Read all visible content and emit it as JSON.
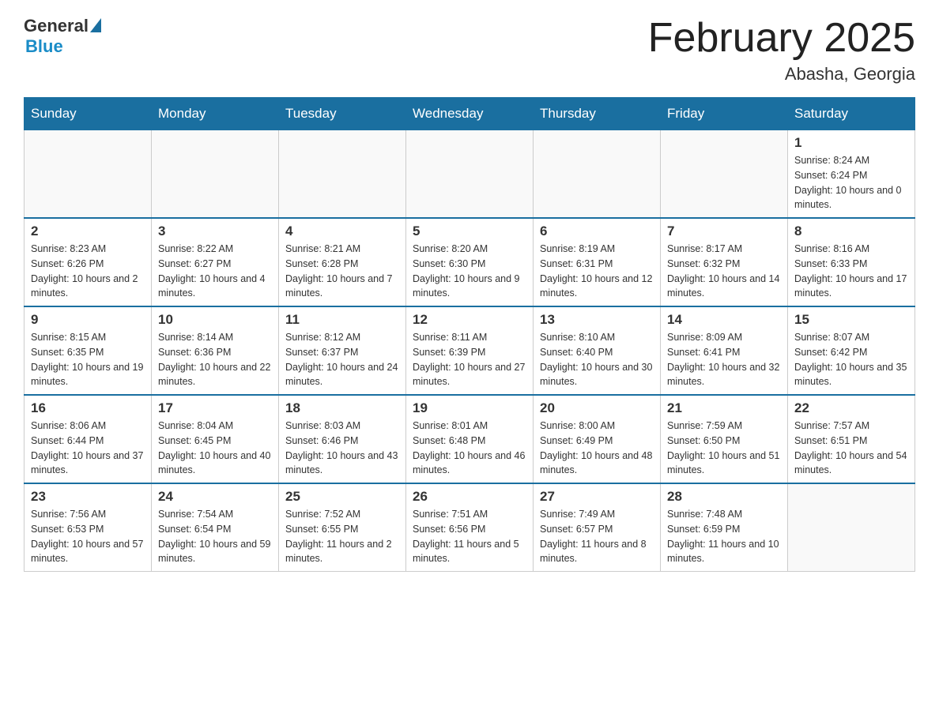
{
  "header": {
    "logo_general": "General",
    "logo_blue": "Blue",
    "title": "February 2025",
    "location": "Abasha, Georgia"
  },
  "calendar": {
    "days_of_week": [
      "Sunday",
      "Monday",
      "Tuesday",
      "Wednesday",
      "Thursday",
      "Friday",
      "Saturday"
    ],
    "weeks": [
      [
        {
          "day": "",
          "info": ""
        },
        {
          "day": "",
          "info": ""
        },
        {
          "day": "",
          "info": ""
        },
        {
          "day": "",
          "info": ""
        },
        {
          "day": "",
          "info": ""
        },
        {
          "day": "",
          "info": ""
        },
        {
          "day": "1",
          "info": "Sunrise: 8:24 AM\nSunset: 6:24 PM\nDaylight: 10 hours and 0 minutes."
        }
      ],
      [
        {
          "day": "2",
          "info": "Sunrise: 8:23 AM\nSunset: 6:26 PM\nDaylight: 10 hours and 2 minutes."
        },
        {
          "day": "3",
          "info": "Sunrise: 8:22 AM\nSunset: 6:27 PM\nDaylight: 10 hours and 4 minutes."
        },
        {
          "day": "4",
          "info": "Sunrise: 8:21 AM\nSunset: 6:28 PM\nDaylight: 10 hours and 7 minutes."
        },
        {
          "day": "5",
          "info": "Sunrise: 8:20 AM\nSunset: 6:30 PM\nDaylight: 10 hours and 9 minutes."
        },
        {
          "day": "6",
          "info": "Sunrise: 8:19 AM\nSunset: 6:31 PM\nDaylight: 10 hours and 12 minutes."
        },
        {
          "day": "7",
          "info": "Sunrise: 8:17 AM\nSunset: 6:32 PM\nDaylight: 10 hours and 14 minutes."
        },
        {
          "day": "8",
          "info": "Sunrise: 8:16 AM\nSunset: 6:33 PM\nDaylight: 10 hours and 17 minutes."
        }
      ],
      [
        {
          "day": "9",
          "info": "Sunrise: 8:15 AM\nSunset: 6:35 PM\nDaylight: 10 hours and 19 minutes."
        },
        {
          "day": "10",
          "info": "Sunrise: 8:14 AM\nSunset: 6:36 PM\nDaylight: 10 hours and 22 minutes."
        },
        {
          "day": "11",
          "info": "Sunrise: 8:12 AM\nSunset: 6:37 PM\nDaylight: 10 hours and 24 minutes."
        },
        {
          "day": "12",
          "info": "Sunrise: 8:11 AM\nSunset: 6:39 PM\nDaylight: 10 hours and 27 minutes."
        },
        {
          "day": "13",
          "info": "Sunrise: 8:10 AM\nSunset: 6:40 PM\nDaylight: 10 hours and 30 minutes."
        },
        {
          "day": "14",
          "info": "Sunrise: 8:09 AM\nSunset: 6:41 PM\nDaylight: 10 hours and 32 minutes."
        },
        {
          "day": "15",
          "info": "Sunrise: 8:07 AM\nSunset: 6:42 PM\nDaylight: 10 hours and 35 minutes."
        }
      ],
      [
        {
          "day": "16",
          "info": "Sunrise: 8:06 AM\nSunset: 6:44 PM\nDaylight: 10 hours and 37 minutes."
        },
        {
          "day": "17",
          "info": "Sunrise: 8:04 AM\nSunset: 6:45 PM\nDaylight: 10 hours and 40 minutes."
        },
        {
          "day": "18",
          "info": "Sunrise: 8:03 AM\nSunset: 6:46 PM\nDaylight: 10 hours and 43 minutes."
        },
        {
          "day": "19",
          "info": "Sunrise: 8:01 AM\nSunset: 6:48 PM\nDaylight: 10 hours and 46 minutes."
        },
        {
          "day": "20",
          "info": "Sunrise: 8:00 AM\nSunset: 6:49 PM\nDaylight: 10 hours and 48 minutes."
        },
        {
          "day": "21",
          "info": "Sunrise: 7:59 AM\nSunset: 6:50 PM\nDaylight: 10 hours and 51 minutes."
        },
        {
          "day": "22",
          "info": "Sunrise: 7:57 AM\nSunset: 6:51 PM\nDaylight: 10 hours and 54 minutes."
        }
      ],
      [
        {
          "day": "23",
          "info": "Sunrise: 7:56 AM\nSunset: 6:53 PM\nDaylight: 10 hours and 57 minutes."
        },
        {
          "day": "24",
          "info": "Sunrise: 7:54 AM\nSunset: 6:54 PM\nDaylight: 10 hours and 59 minutes."
        },
        {
          "day": "25",
          "info": "Sunrise: 7:52 AM\nSunset: 6:55 PM\nDaylight: 11 hours and 2 minutes."
        },
        {
          "day": "26",
          "info": "Sunrise: 7:51 AM\nSunset: 6:56 PM\nDaylight: 11 hours and 5 minutes."
        },
        {
          "day": "27",
          "info": "Sunrise: 7:49 AM\nSunset: 6:57 PM\nDaylight: 11 hours and 8 minutes."
        },
        {
          "day": "28",
          "info": "Sunrise: 7:48 AM\nSunset: 6:59 PM\nDaylight: 11 hours and 10 minutes."
        },
        {
          "day": "",
          "info": ""
        }
      ]
    ]
  }
}
